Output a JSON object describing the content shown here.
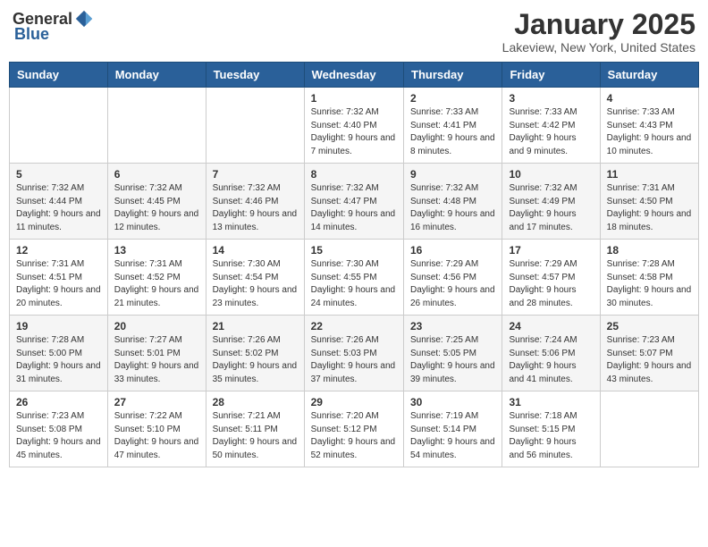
{
  "header": {
    "logo_general": "General",
    "logo_blue": "Blue",
    "title": "January 2025",
    "location": "Lakeview, New York, United States"
  },
  "weekdays": [
    "Sunday",
    "Monday",
    "Tuesday",
    "Wednesday",
    "Thursday",
    "Friday",
    "Saturday"
  ],
  "weeks": [
    [
      {
        "day": "",
        "info": ""
      },
      {
        "day": "",
        "info": ""
      },
      {
        "day": "",
        "info": ""
      },
      {
        "day": "1",
        "info": "Sunrise: 7:32 AM\nSunset: 4:40 PM\nDaylight: 9 hours and 7 minutes."
      },
      {
        "day": "2",
        "info": "Sunrise: 7:33 AM\nSunset: 4:41 PM\nDaylight: 9 hours and 8 minutes."
      },
      {
        "day": "3",
        "info": "Sunrise: 7:33 AM\nSunset: 4:42 PM\nDaylight: 9 hours and 9 minutes."
      },
      {
        "day": "4",
        "info": "Sunrise: 7:33 AM\nSunset: 4:43 PM\nDaylight: 9 hours and 10 minutes."
      }
    ],
    [
      {
        "day": "5",
        "info": "Sunrise: 7:32 AM\nSunset: 4:44 PM\nDaylight: 9 hours and 11 minutes."
      },
      {
        "day": "6",
        "info": "Sunrise: 7:32 AM\nSunset: 4:45 PM\nDaylight: 9 hours and 12 minutes."
      },
      {
        "day": "7",
        "info": "Sunrise: 7:32 AM\nSunset: 4:46 PM\nDaylight: 9 hours and 13 minutes."
      },
      {
        "day": "8",
        "info": "Sunrise: 7:32 AM\nSunset: 4:47 PM\nDaylight: 9 hours and 14 minutes."
      },
      {
        "day": "9",
        "info": "Sunrise: 7:32 AM\nSunset: 4:48 PM\nDaylight: 9 hours and 16 minutes."
      },
      {
        "day": "10",
        "info": "Sunrise: 7:32 AM\nSunset: 4:49 PM\nDaylight: 9 hours and 17 minutes."
      },
      {
        "day": "11",
        "info": "Sunrise: 7:31 AM\nSunset: 4:50 PM\nDaylight: 9 hours and 18 minutes."
      }
    ],
    [
      {
        "day": "12",
        "info": "Sunrise: 7:31 AM\nSunset: 4:51 PM\nDaylight: 9 hours and 20 minutes."
      },
      {
        "day": "13",
        "info": "Sunrise: 7:31 AM\nSunset: 4:52 PM\nDaylight: 9 hours and 21 minutes."
      },
      {
        "day": "14",
        "info": "Sunrise: 7:30 AM\nSunset: 4:54 PM\nDaylight: 9 hours and 23 minutes."
      },
      {
        "day": "15",
        "info": "Sunrise: 7:30 AM\nSunset: 4:55 PM\nDaylight: 9 hours and 24 minutes."
      },
      {
        "day": "16",
        "info": "Sunrise: 7:29 AM\nSunset: 4:56 PM\nDaylight: 9 hours and 26 minutes."
      },
      {
        "day": "17",
        "info": "Sunrise: 7:29 AM\nSunset: 4:57 PM\nDaylight: 9 hours and 28 minutes."
      },
      {
        "day": "18",
        "info": "Sunrise: 7:28 AM\nSunset: 4:58 PM\nDaylight: 9 hours and 30 minutes."
      }
    ],
    [
      {
        "day": "19",
        "info": "Sunrise: 7:28 AM\nSunset: 5:00 PM\nDaylight: 9 hours and 31 minutes."
      },
      {
        "day": "20",
        "info": "Sunrise: 7:27 AM\nSunset: 5:01 PM\nDaylight: 9 hours and 33 minutes."
      },
      {
        "day": "21",
        "info": "Sunrise: 7:26 AM\nSunset: 5:02 PM\nDaylight: 9 hours and 35 minutes."
      },
      {
        "day": "22",
        "info": "Sunrise: 7:26 AM\nSunset: 5:03 PM\nDaylight: 9 hours and 37 minutes."
      },
      {
        "day": "23",
        "info": "Sunrise: 7:25 AM\nSunset: 5:05 PM\nDaylight: 9 hours and 39 minutes."
      },
      {
        "day": "24",
        "info": "Sunrise: 7:24 AM\nSunset: 5:06 PM\nDaylight: 9 hours and 41 minutes."
      },
      {
        "day": "25",
        "info": "Sunrise: 7:23 AM\nSunset: 5:07 PM\nDaylight: 9 hours and 43 minutes."
      }
    ],
    [
      {
        "day": "26",
        "info": "Sunrise: 7:23 AM\nSunset: 5:08 PM\nDaylight: 9 hours and 45 minutes."
      },
      {
        "day": "27",
        "info": "Sunrise: 7:22 AM\nSunset: 5:10 PM\nDaylight: 9 hours and 47 minutes."
      },
      {
        "day": "28",
        "info": "Sunrise: 7:21 AM\nSunset: 5:11 PM\nDaylight: 9 hours and 50 minutes."
      },
      {
        "day": "29",
        "info": "Sunrise: 7:20 AM\nSunset: 5:12 PM\nDaylight: 9 hours and 52 minutes."
      },
      {
        "day": "30",
        "info": "Sunrise: 7:19 AM\nSunset: 5:14 PM\nDaylight: 9 hours and 54 minutes."
      },
      {
        "day": "31",
        "info": "Sunrise: 7:18 AM\nSunset: 5:15 PM\nDaylight: 9 hours and 56 minutes."
      },
      {
        "day": "",
        "info": ""
      }
    ]
  ]
}
